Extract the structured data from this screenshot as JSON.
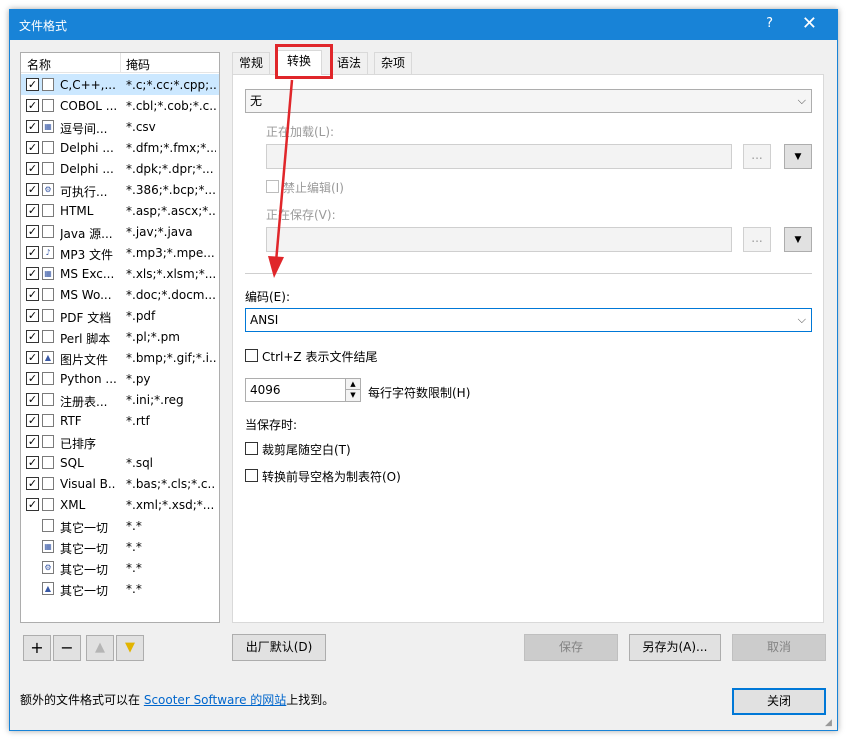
{
  "window": {
    "title": "文件格式",
    "help": "?",
    "close": "✕"
  },
  "filelist": {
    "col_name": "名称",
    "col_mask": "掩码",
    "rows": [
      {
        "name": "C,C++,...",
        "mask": "*.c;*.cc;*.cpp;...",
        "checked": true,
        "icon": "doc-icon",
        "selected": true
      },
      {
        "name": "COBOL ...",
        "mask": "*.cbl;*.cob;*.c...",
        "checked": true,
        "icon": "doc-icon"
      },
      {
        "name": "逗号间...",
        "mask": "*.csv",
        "checked": true,
        "icon": "table-icon"
      },
      {
        "name": "Delphi ...",
        "mask": "*.dfm;*.fmx;*...",
        "checked": true,
        "icon": "doc-icon"
      },
      {
        "name": "Delphi ...",
        "mask": "*.dpk;*.dpr;*...",
        "checked": true,
        "icon": "doc-icon"
      },
      {
        "name": "可执行...",
        "mask": "*.386;*.bcp;*...",
        "checked": true,
        "icon": "binary-icon"
      },
      {
        "name": "HTML",
        "mask": "*.asp;*.ascx;*...",
        "checked": true,
        "icon": "doc-icon"
      },
      {
        "name": "Java 源...",
        "mask": "*.jav;*.java",
        "checked": true,
        "icon": "doc-icon"
      },
      {
        "name": "MP3 文件",
        "mask": "*.mp3;*.mpe...",
        "checked": true,
        "icon": "music-icon"
      },
      {
        "name": "MS Exc...",
        "mask": "*.xls;*.xlsm;*...",
        "checked": true,
        "icon": "table-icon"
      },
      {
        "name": "MS Wo...",
        "mask": "*.doc;*.docm...",
        "checked": true,
        "icon": "doc-icon"
      },
      {
        "name": "PDF 文档",
        "mask": "*.pdf",
        "checked": true,
        "icon": "doc-icon"
      },
      {
        "name": "Perl 脚本",
        "mask": "*.pl;*.pm",
        "checked": true,
        "icon": "doc-icon"
      },
      {
        "name": "图片文件",
        "mask": "*.bmp;*.gif;*.i...",
        "checked": true,
        "icon": "image-icon"
      },
      {
        "name": "Python ...",
        "mask": "*.py",
        "checked": true,
        "icon": "doc-icon"
      },
      {
        "name": "注册表...",
        "mask": "*.ini;*.reg",
        "checked": true,
        "icon": "doc-icon"
      },
      {
        "name": "RTF",
        "mask": "*.rtf",
        "checked": true,
        "icon": "doc-icon"
      },
      {
        "name": "已排序",
        "mask": "",
        "checked": true,
        "icon": "doc-icon"
      },
      {
        "name": "SQL",
        "mask": "*.sql",
        "checked": true,
        "icon": "doc-icon"
      },
      {
        "name": "Visual B...",
        "mask": "*.bas;*.cls;*.c...",
        "checked": true,
        "icon": "doc-icon"
      },
      {
        "name": "XML",
        "mask": "*.xml;*.xsd;*...",
        "checked": true,
        "icon": "doc-icon"
      },
      {
        "name": "其它一切",
        "mask": "*.*",
        "checked": false,
        "icon": "doc-icon"
      },
      {
        "name": "其它一切",
        "mask": "*.*",
        "checked": false,
        "icon": "table-icon"
      },
      {
        "name": "其它一切",
        "mask": "*.*",
        "checked": false,
        "icon": "binary-icon"
      },
      {
        "name": "其它一切",
        "mask": "*.*",
        "checked": false,
        "icon": "image-icon"
      }
    ]
  },
  "list_buttons": {
    "add": "+",
    "remove": "−",
    "up": "🡅",
    "down": "🡇"
  },
  "tabs": [
    "常规",
    "转换",
    "语法",
    "杂项"
  ],
  "conversion": {
    "type_value": "无",
    "loading_label": "正在加载(L):",
    "browse_label": "...",
    "disable_edit_label": "禁止编辑(I)",
    "saving_label": "正在保存(V):",
    "encoding_label": "编码(E):",
    "encoding_value": "ANSI",
    "ctrlz_label": "Ctrl+Z 表示文件结尾",
    "line_limit_value": "4096",
    "line_limit_label": "每行字符数限制(H)",
    "on_save_label": "当保存时:",
    "trim_trailing_label": "裁剪尾随空白(T)",
    "leading_spaces_label": "转换前导空格为制表符(O)"
  },
  "buttons": {
    "factory_defaults": "出厂默认(D)",
    "save": "保存",
    "save_as": "另存为(A)...",
    "cancel": "取消",
    "close": "关闭"
  },
  "status": {
    "prefix": "额外的文件格式可以在 ",
    "link": "Scooter Software 的网站",
    "suffix": "上找到。"
  },
  "colors": {
    "accent": "#1883d7",
    "annotation": "#e0262a",
    "selection": "#cce8ff"
  }
}
